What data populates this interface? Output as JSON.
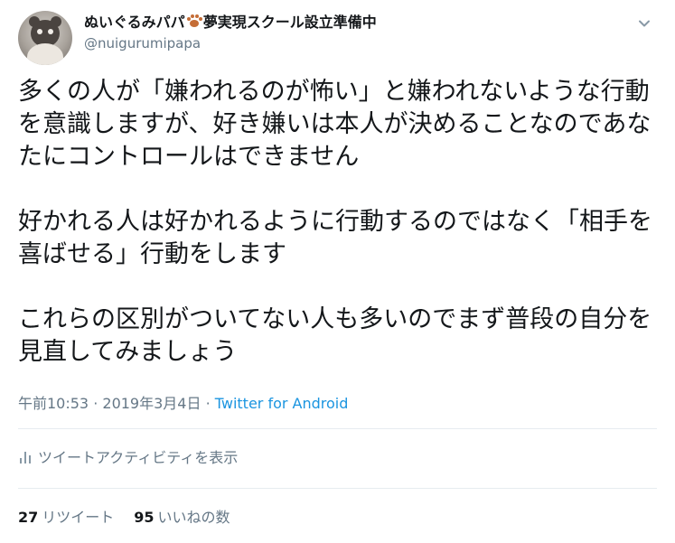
{
  "user": {
    "display_name_prefix": "ぬいぐるみパパ",
    "display_name_suffix": "夢実現スクール設立準備中",
    "handle": "@nuigurumipapa",
    "paw_emoji_color": "#c56d36"
  },
  "menu": {
    "icon": "chevron-down-icon"
  },
  "tweet": {
    "paragraphs": [
      "多くの人が「嫌われるのが怖い」と嫌われないような行動を意識しますが、好き嫌いは本人が決めることなのであなたにコントロールはできません",
      "好かれる人は好かれるように行動するのではなく「相手を喜ばせる」行動をします",
      "これらの区別がついてない人も多いのでまず普段の自分を見直してみましょう"
    ]
  },
  "meta": {
    "time": "午前10:53",
    "separator": " · ",
    "date": "2019年3月4日",
    "source": "Twitter for Android"
  },
  "activity": {
    "icon": "bar-chart-icon",
    "label": "ツイートアクティビティを表示"
  },
  "stats": {
    "retweets_count": "27",
    "retweets_label": "リツイート",
    "likes_count": "95",
    "likes_label": "いいねの数"
  },
  "colors": {
    "text_primary": "#14171a",
    "text_secondary": "#657786",
    "link": "#1b95e0",
    "divider": "#e6ecf0"
  }
}
